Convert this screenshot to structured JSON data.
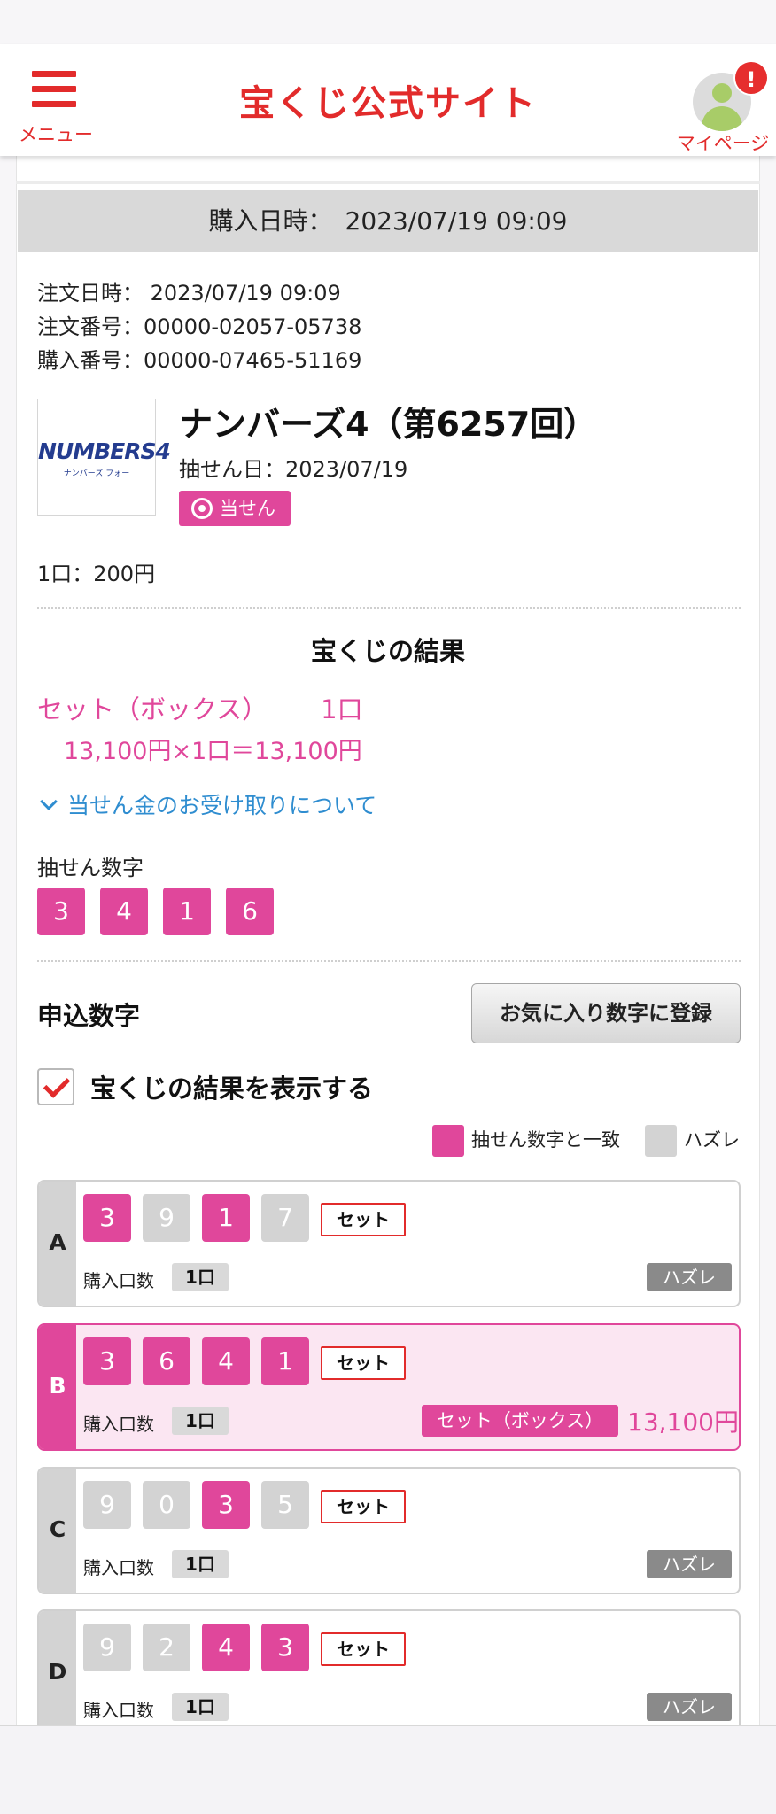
{
  "header": {
    "menu_label": "メニュー",
    "site_title": "宝くじ公式サイト",
    "mypage_label": "マイページ",
    "notification_badge": "!"
  },
  "purchase": {
    "datetime_label": "購入日時：",
    "datetime_value": "2023/07/19 09:09"
  },
  "order": {
    "order_datetime": "注文日時： 2023/07/19 09:09",
    "order_number": "注文番号：00000-02057-05738",
    "purchase_number": "購入番号：00000-07465-51169"
  },
  "game": {
    "logo_text": "NUMBERS4",
    "logo_subtext": "ナンバーズ フォー",
    "title": "ナンバーズ4（第6257回）",
    "draw_date": "抽せん日：2023/07/19",
    "status_tag": "当せん",
    "unit_price": "1口：200円"
  },
  "result": {
    "heading": "宝くじの結果",
    "prize_type": "セット（ボックス）",
    "prize_count": "1口",
    "formula": "13,100円×1口＝13,100円",
    "receive_link": "当せん金のお受け取りについて",
    "draw_numbers_label": "抽せん数字",
    "draw_numbers": [
      "3",
      "4",
      "1",
      "6"
    ]
  },
  "application": {
    "label": "申込数字",
    "favorite_button": "お気に入り数字に登録",
    "show_result_checkbox_label": "宝くじの結果を表示する",
    "show_result_checked": true,
    "legend_match": "抽せん数字と一致",
    "legend_miss": "ハズレ"
  },
  "colors": {
    "brand_red": "#e22b2b",
    "match_pink": "#e0479b",
    "miss_grey": "#d3d3d3",
    "link_blue": "#2f8dd0"
  },
  "entries": [
    {
      "letter": "A",
      "numbers": [
        {
          "v": "3",
          "match": true
        },
        {
          "v": "9",
          "match": false
        },
        {
          "v": "1",
          "match": true
        },
        {
          "v": "7",
          "match": false
        }
      ],
      "type_tag": "セット",
      "qty_label": "購入口数",
      "qty": "1口",
      "result": "ハズレ"
    },
    {
      "letter": "B",
      "numbers": [
        {
          "v": "3",
          "match": true
        },
        {
          "v": "6",
          "match": true
        },
        {
          "v": "4",
          "match": true
        },
        {
          "v": "1",
          "match": true
        }
      ],
      "type_tag": "セット",
      "qty_label": "購入口数",
      "qty": "1口",
      "result": "セット（ボックス）",
      "amount": "13,100円"
    },
    {
      "letter": "C",
      "numbers": [
        {
          "v": "9",
          "match": false
        },
        {
          "v": "0",
          "match": false
        },
        {
          "v": "3",
          "match": true
        },
        {
          "v": "5",
          "match": false
        }
      ],
      "type_tag": "セット",
      "qty_label": "購入口数",
      "qty": "1口",
      "result": "ハズレ"
    },
    {
      "letter": "D",
      "numbers": [
        {
          "v": "9",
          "match": false
        },
        {
          "v": "2",
          "match": false
        },
        {
          "v": "4",
          "match": true
        },
        {
          "v": "3",
          "match": true
        }
      ],
      "type_tag": "セット",
      "qty_label": "購入口数",
      "qty": "1口",
      "result": "ハズレ"
    }
  ]
}
